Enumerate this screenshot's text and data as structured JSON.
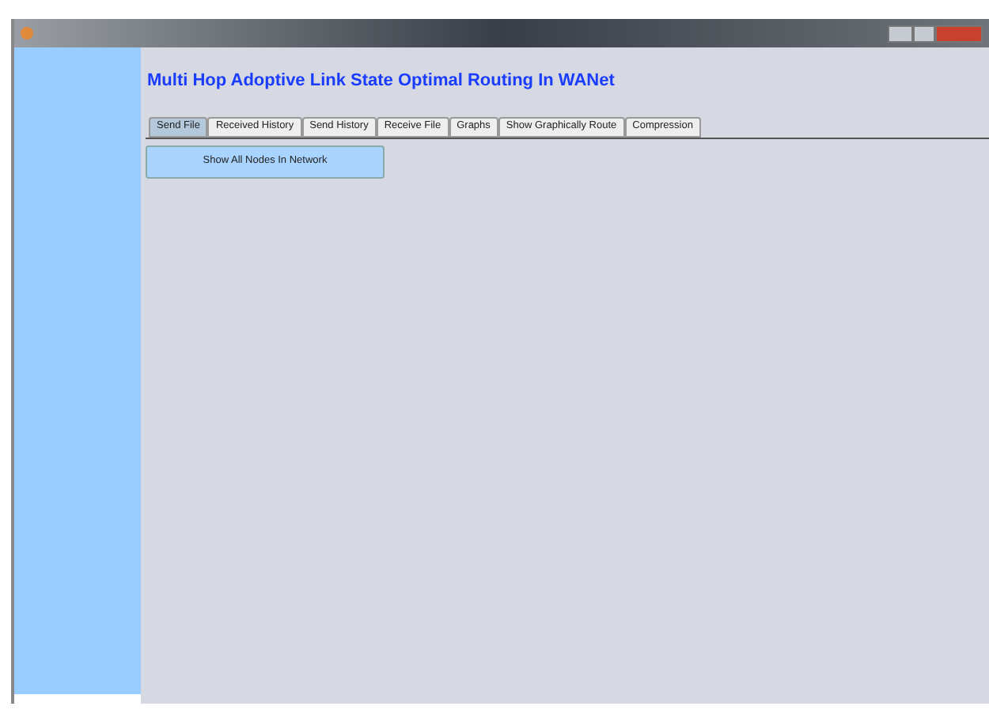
{
  "heading": "Multi Hop Adoptive Link State Optimal Routing In WANet",
  "tabs": [
    {
      "label": "Send File",
      "selected": true
    },
    {
      "label": "Received History",
      "selected": false
    },
    {
      "label": "Send History",
      "selected": false
    },
    {
      "label": "Receive File",
      "selected": false
    },
    {
      "label": "Graphs",
      "selected": false
    },
    {
      "label": "Show Graphically Route",
      "selected": false
    },
    {
      "label": "Compression",
      "selected": false
    }
  ],
  "action_button": "Show All Nodes In Network"
}
